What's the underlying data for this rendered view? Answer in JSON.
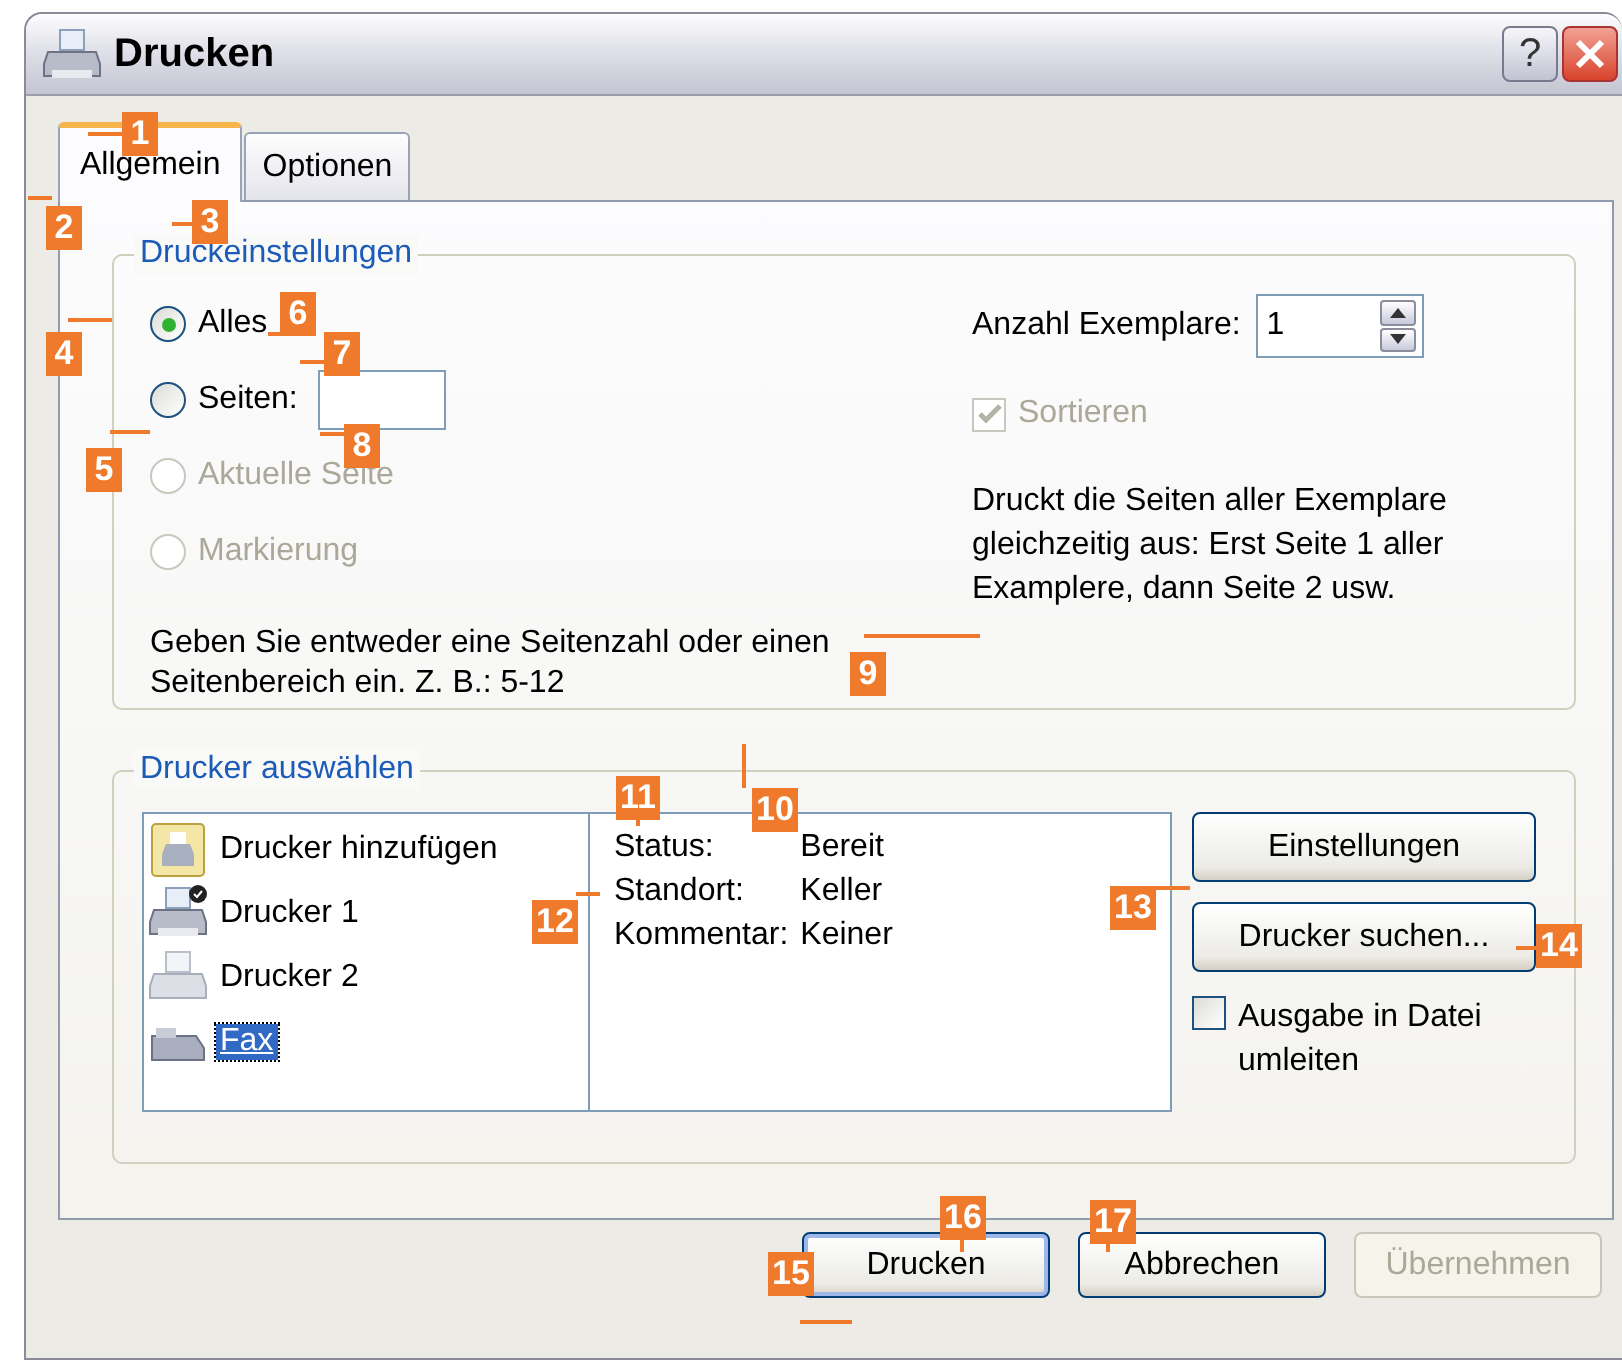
{
  "window": {
    "title": "Drucken",
    "help_button": "?"
  },
  "tabs": [
    {
      "label": "Allgemein",
      "selected": true
    },
    {
      "label": "Optionen",
      "selected": false
    }
  ],
  "print_settings": {
    "title": "Druckeinstellungen",
    "ranges": [
      {
        "label": "Alles",
        "selected": true,
        "disabled": false
      },
      {
        "label": "Seiten:",
        "selected": false,
        "disabled": false,
        "kind": "field"
      },
      {
        "label": "Aktuelle Seite",
        "selected": false,
        "disabled": true
      },
      {
        "label": "Markierung",
        "selected": false,
        "disabled": true
      }
    ],
    "range_hint": "Geben Sie entweder eine Seitenzahl oder einen Seitenbereich ein. Z. B.: 5-12",
    "copies": {
      "label": "Anzahl Exemplare:",
      "value": "1"
    },
    "collate": {
      "label": "Sortieren",
      "checked": true,
      "disabled": true
    },
    "collate_hint": "Druckt die Seiten aller Exemplare gleichzeitig aus: Erst Seite 1 aller Examplere, dann Seite 2 usw."
  },
  "printer_select": {
    "title": "Drucker auswählen",
    "printers": [
      {
        "name": "Drucker hinzufügen",
        "kind": "add",
        "selected": false
      },
      {
        "name": "Drucker 1",
        "kind": "default",
        "selected": false
      },
      {
        "name": "Drucker 2",
        "kind": "printer",
        "selected": false
      },
      {
        "name": "Fax",
        "kind": "fax",
        "selected": true
      }
    ],
    "details": [
      {
        "label": "Status:",
        "value": "Bereit"
      },
      {
        "label": "Standort:",
        "value": "Keller"
      },
      {
        "label": "Kommentar:",
        "value": "Keiner"
      }
    ],
    "buttons": [
      "Einstellungen",
      "Drucker suchen..."
    ],
    "print_to_file": {
      "label": "Ausgabe in Datei umleiten",
      "checked": false
    }
  },
  "buttons": [
    {
      "label": "Drucken",
      "disabled": false,
      "default": true
    },
    {
      "label": "Abbrechen",
      "disabled": false,
      "default": false
    },
    {
      "label": "Übernehmen",
      "disabled": true,
      "default": false
    }
  ],
  "callouts": [
    "1",
    "2",
    "3",
    "4",
    "5",
    "6",
    "7",
    "8",
    "9",
    "10",
    "11",
    "12",
    "13",
    "14",
    "15",
    "16",
    "17"
  ]
}
